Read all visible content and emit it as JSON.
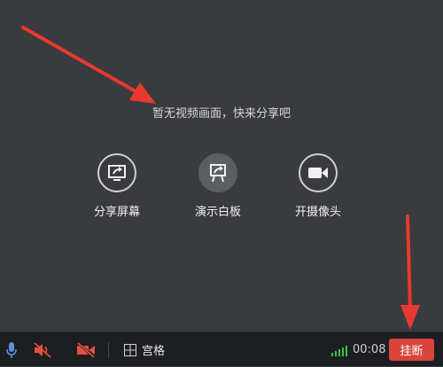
{
  "stage": {
    "empty_message": "暂无视频画面，快来分享吧",
    "actions": [
      {
        "label": "分享屏幕",
        "icon": "share-screen-icon"
      },
      {
        "label": "演示白板",
        "icon": "whiteboard-icon"
      },
      {
        "label": "开摄像头",
        "icon": "camera-icon"
      }
    ],
    "annotation_color": "#e8392f"
  },
  "bottombar": {
    "mic_icon": "microphone-icon",
    "speaker_icon": "speaker-muted-icon",
    "video_icon": "video-off-icon",
    "grid_label": "宫格",
    "grid_icon": "grid-icon",
    "signal_icon": "signal-bars-icon",
    "timer": "00:08",
    "hangup_label": "挂断",
    "hangup_color": "#d9443c",
    "muted_color": "#e0533f"
  }
}
